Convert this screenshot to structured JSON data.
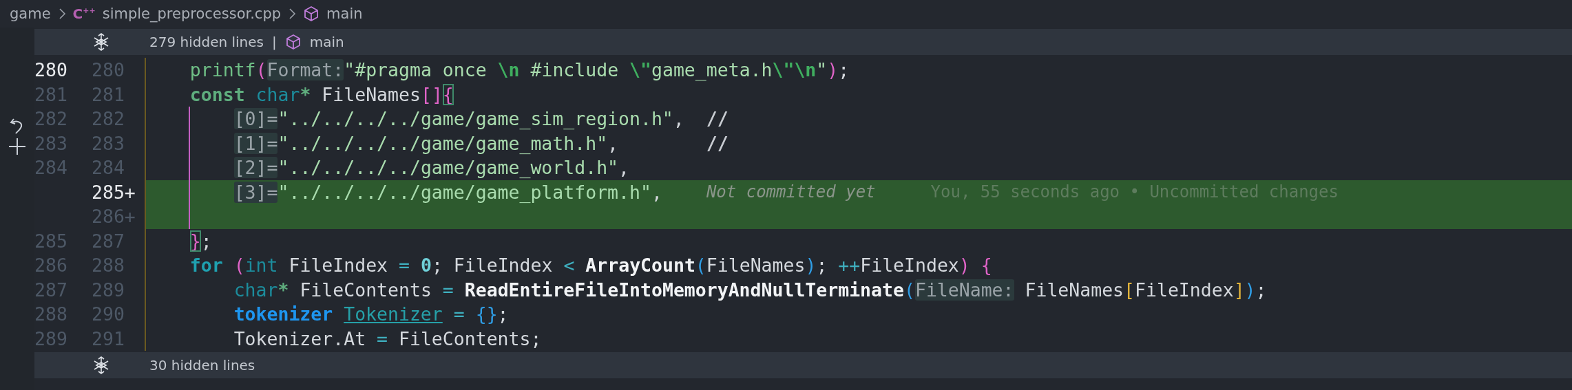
{
  "breadcrumb": [
    {
      "label": "game",
      "kind": "folder"
    },
    {
      "label": "simple_preprocessor.cpp",
      "kind": "file",
      "icon_label": "C$^{++}$"
    },
    {
      "label": "main",
      "kind": "symbol"
    }
  ],
  "hidden_top": {
    "count": "279 hidden lines",
    "separator": "|",
    "symbol": "main"
  },
  "lines": [
    {
      "old": "280",
      "new": "280",
      "kind": "context",
      "old_active": true,
      "new_active": false,
      "in_scope": false,
      "tokens": [
        {
          "t": "    printf",
          "kind": "fn"
        },
        {
          "t": "(",
          "kind": "bp"
        },
        {
          "t": "Format:",
          "kind": "hint"
        },
        {
          "t": "\"#pragma once ",
          "kind": "str"
        },
        {
          "t": "\\n",
          "kind": "esc"
        },
        {
          "t": " #include ",
          "kind": "str"
        },
        {
          "t": "\\\"",
          "kind": "esc"
        },
        {
          "t": "game_meta.h",
          "kind": "str"
        },
        {
          "t": "\\\"\\n",
          "kind": "esc"
        },
        {
          "t": "\"",
          "kind": "str"
        },
        {
          "t": ")",
          "kind": "bp"
        },
        {
          "t": ";",
          "kind": "plain"
        }
      ]
    },
    {
      "old": "281",
      "new": "281",
      "kind": "context",
      "old_active": false,
      "new_active": false,
      "in_scope": false,
      "tokens": [
        {
          "t": "    const ",
          "kind": "kw"
        },
        {
          "t": "char",
          "kind": "type"
        },
        {
          "t": "*",
          "kind": "star"
        },
        {
          "t": " FileNames",
          "kind": "plain"
        },
        {
          "t": "[]",
          "kind": "bp"
        },
        {
          "t": "{",
          "kind": "bpm"
        }
      ]
    },
    {
      "old": "282",
      "new": "282",
      "kind": "context",
      "old_active": false,
      "new_active": false,
      "in_scope": true,
      "tokens": [
        {
          "t": "        [0]=",
          "kind": "hint"
        },
        {
          "t": "\"../../../../game/game_sim_region.h\"",
          "kind": "str"
        },
        {
          "t": ",  ",
          "kind": "plain"
        },
        {
          "t": "//",
          "kind": "comment"
        }
      ]
    },
    {
      "old": "283",
      "new": "283",
      "kind": "context",
      "old_active": false,
      "new_active": false,
      "in_scope": true,
      "tokens": [
        {
          "t": "        [1]=",
          "kind": "hint"
        },
        {
          "t": "\"../../../../game/game_math.h\"",
          "kind": "str"
        },
        {
          "t": ",        ",
          "kind": "plain"
        },
        {
          "t": "//",
          "kind": "comment"
        }
      ]
    },
    {
      "old": "284",
      "new": "284",
      "kind": "context",
      "old_active": false,
      "new_active": false,
      "in_scope": true,
      "tokens": [
        {
          "t": "        [2]=",
          "kind": "hint"
        },
        {
          "t": "\"../../../../game/game_world.h\"",
          "kind": "str"
        },
        {
          "t": ",",
          "kind": "plain"
        }
      ]
    },
    {
      "new": "285+",
      "kind": "added",
      "old_active": false,
      "new_active": true,
      "in_scope": true,
      "tokens": [
        {
          "t": "        [3]=",
          "kind": "hint"
        },
        {
          "t": "\"../../../../game/game_platform.h\"",
          "kind": "str"
        },
        {
          "t": ",",
          "kind": "plain"
        }
      ],
      "blame": {
        "note": "Not committed yet",
        "detail": "You, 55 seconds ago • Uncommitted changes"
      }
    },
    {
      "new": "286+",
      "kind": "added",
      "old_active": false,
      "new_active": false,
      "in_scope": true
    },
    {
      "old": "285",
      "new": "287",
      "kind": "context",
      "old_active": false,
      "new_active": false,
      "in_scope": false,
      "tokens": [
        {
          "t": "    }",
          "kind": "bpm"
        },
        {
          "t": ";",
          "kind": "plain"
        }
      ]
    },
    {
      "old": "286",
      "new": "288",
      "kind": "context",
      "old_active": false,
      "new_active": false,
      "in_scope": false,
      "tokens": [
        {
          "t": "    for ",
          "kind": "kw2"
        },
        {
          "t": "(",
          "kind": "bp"
        },
        {
          "t": "int",
          "kind": "type"
        },
        {
          "t": " FileIndex ",
          "kind": "plain"
        },
        {
          "t": "=",
          "kind": "op"
        },
        {
          "t": " 0",
          "kind": "num"
        },
        {
          "t": "; FileIndex ",
          "kind": "plain"
        },
        {
          "t": "<",
          "kind": "op"
        },
        {
          "t": " ArrayCount",
          "kind": "bfn"
        },
        {
          "t": "(",
          "kind": "bb"
        },
        {
          "t": "FileNames",
          "kind": "plain"
        },
        {
          "t": ")",
          "kind": "bb"
        },
        {
          "t": "; ",
          "kind": "plain"
        },
        {
          "t": "++",
          "kind": "op"
        },
        {
          "t": "FileIndex",
          "kind": "plain"
        },
        {
          "t": ")",
          "kind": "bp"
        },
        {
          "t": " {",
          "kind": "bp"
        }
      ]
    },
    {
      "old": "287",
      "new": "289",
      "kind": "context",
      "old_active": false,
      "new_active": false,
      "in_scope": false,
      "tokens": [
        {
          "t": "        char",
          "kind": "type"
        },
        {
          "t": "*",
          "kind": "star"
        },
        {
          "t": " FileContents ",
          "kind": "plain"
        },
        {
          "t": "=",
          "kind": "op"
        },
        {
          "t": " ReadEntireFileIntoMemoryAndNullTerminate",
          "kind": "bfn"
        },
        {
          "t": "(",
          "kind": "bb"
        },
        {
          "t": "FileName:",
          "kind": "hint"
        },
        {
          "t": " FileNames",
          "kind": "plain"
        },
        {
          "t": "[",
          "kind": "by"
        },
        {
          "t": "FileIndex",
          "kind": "plain"
        },
        {
          "t": "]",
          "kind": "by"
        },
        {
          "t": ")",
          "kind": "bb"
        },
        {
          "t": ";",
          "kind": "plain"
        }
      ]
    },
    {
      "old": "288",
      "new": "290",
      "kind": "context",
      "old_active": false,
      "new_active": false,
      "in_scope": false,
      "tokens": [
        {
          "t": "        tokenizer ",
          "kind": "struct"
        },
        {
          "t": "Tokenizer",
          "kind": "var"
        },
        {
          "t": " = ",
          "kind": "op"
        },
        {
          "t": "{}",
          "kind": "bb"
        },
        {
          "t": ";",
          "kind": "plain"
        }
      ]
    },
    {
      "old": "289",
      "new": "291",
      "kind": "context",
      "old_active": false,
      "new_active": false,
      "in_scope": false,
      "tokens": [
        {
          "t": "        Tokenizer.At ",
          "kind": "plain"
        },
        {
          "t": "=",
          "kind": "op"
        },
        {
          "t": " FileContents;",
          "kind": "plain"
        }
      ]
    }
  ],
  "hidden_bottom": {
    "count": "30 hidden lines"
  }
}
